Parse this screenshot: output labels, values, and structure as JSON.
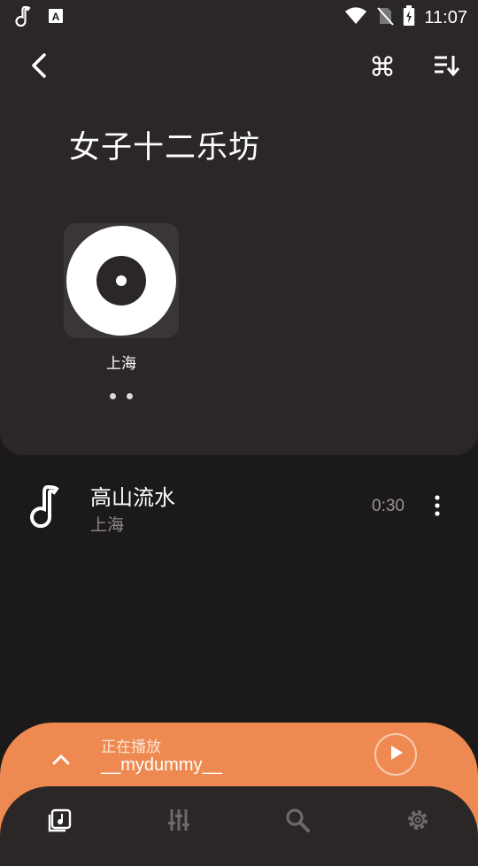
{
  "status_bar": {
    "time": "11:07",
    "icons": [
      "music-note-icon",
      "font-a-icon",
      "wifi-icon",
      "no-sim-icon",
      "battery-charging-icon"
    ]
  },
  "toolbar": {
    "back_icon": "chevron-left-icon",
    "command_icon": "command-icon",
    "command_glyph": "⌘",
    "sort_icon": "sort-descending-icon"
  },
  "page": {
    "title": "女子十二乐坊"
  },
  "albums": [
    {
      "label": "上海",
      "icon": "vinyl-record-icon"
    }
  ],
  "pager": {
    "pages": 2
  },
  "tracks": [
    {
      "title": "高山流水",
      "artist": "上海",
      "duration": "0:30",
      "icon": "music-note-icon",
      "more_icon": "more-vertical-icon"
    }
  ],
  "now_playing": {
    "label": "正在播放",
    "title": "__mydummy__",
    "expand_icon": "chevron-up-icon",
    "play_icon": "play-icon"
  },
  "bottom_nav": {
    "items": [
      {
        "name": "library",
        "icon": "music-library-icon",
        "active": true
      },
      {
        "name": "equalizer",
        "icon": "equalizer-icon",
        "active": false
      },
      {
        "name": "search",
        "icon": "search-icon",
        "active": false
      },
      {
        "name": "settings",
        "icon": "settings-gear-icon",
        "active": false
      }
    ]
  },
  "colors": {
    "background": "#1b1919",
    "card": "#2b2727",
    "accent": "#ee8a51",
    "muted_text": "#8f8a8a",
    "inactive_nav": "#6e6868"
  }
}
